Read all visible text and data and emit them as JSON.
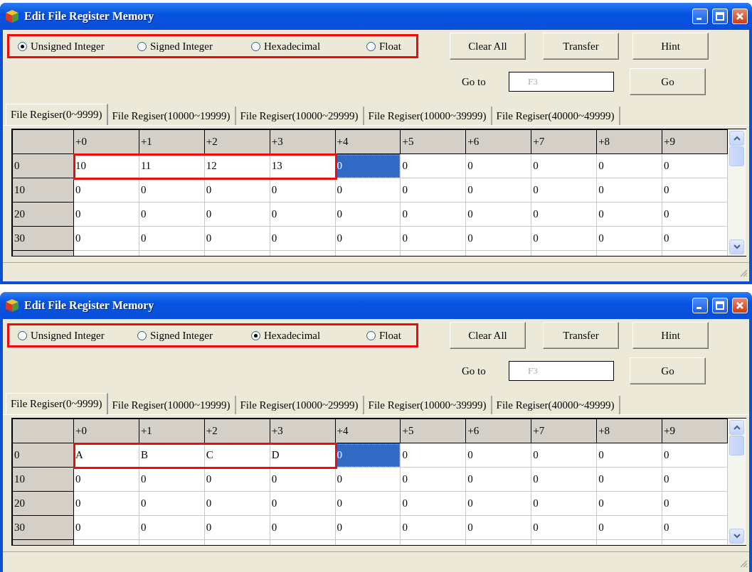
{
  "windows": [
    {
      "title": "Edit File Register Memory",
      "format_group": {
        "highlighted": true,
        "options": [
          {
            "label": "Unsigned Integer",
            "selected": true
          },
          {
            "label": "Signed Integer",
            "selected": false
          },
          {
            "label": "Hexadecimal",
            "selected": false
          },
          {
            "label": "Float",
            "selected": false
          }
        ]
      },
      "buttons": [
        "Clear All",
        "Transfer",
        "Hint"
      ],
      "goto": {
        "label": "Go to",
        "placeholder": "F3",
        "button": "Go"
      },
      "tabs": [
        {
          "label": "File Regiser(0~9999)",
          "selected": true
        },
        {
          "label": "File Regiser(10000~19999)",
          "selected": false
        },
        {
          "label": "File Regiser(10000~29999)",
          "selected": false
        },
        {
          "label": "File Regiser(10000~39999)",
          "selected": false
        },
        {
          "label": "File Regiser(40000~49999)",
          "selected": false
        }
      ],
      "grid": {
        "columns": [
          "+0",
          "+1",
          "+2",
          "+3",
          "+4",
          "+5",
          "+6",
          "+7",
          "+8",
          "+9"
        ],
        "rows": [
          {
            "header": "0",
            "cells": [
              {
                "text": "10",
                "selected": false,
                "highlighted": true
              },
              {
                "text": "11",
                "selected": false,
                "highlighted": true
              },
              {
                "text": "12",
                "selected": false,
                "highlighted": true
              },
              {
                "text": "13",
                "selected": false,
                "highlighted": true
              },
              {
                "text": "0",
                "selected": true,
                "highlighted": false
              },
              {
                "text": "0",
                "selected": false,
                "highlighted": false
              },
              {
                "text": "0",
                "selected": false,
                "highlighted": false
              },
              {
                "text": "0",
                "selected": false,
                "highlighted": false
              },
              {
                "text": "0",
                "selected": false,
                "highlighted": false
              },
              {
                "text": "0",
                "selected": false,
                "highlighted": false
              }
            ]
          },
          {
            "header": "10",
            "cells": [
              {
                "text": "0",
                "selected": false,
                "highlighted": false
              },
              {
                "text": "0",
                "selected": false,
                "highlighted": false
              },
              {
                "text": "0",
                "selected": false,
                "highlighted": false
              },
              {
                "text": "0",
                "selected": false,
                "highlighted": false
              },
              {
                "text": "0",
                "selected": false,
                "highlighted": false
              },
              {
                "text": "0",
                "selected": false,
                "highlighted": false
              },
              {
                "text": "0",
                "selected": false,
                "highlighted": false
              },
              {
                "text": "0",
                "selected": false,
                "highlighted": false
              },
              {
                "text": "0",
                "selected": false,
                "highlighted": false
              },
              {
                "text": "0",
                "selected": false,
                "highlighted": false
              }
            ]
          },
          {
            "header": "20",
            "cells": [
              {
                "text": "0",
                "selected": false,
                "highlighted": false
              },
              {
                "text": "0",
                "selected": false,
                "highlighted": false
              },
              {
                "text": "0",
                "selected": false,
                "highlighted": false
              },
              {
                "text": "0",
                "selected": false,
                "highlighted": false
              },
              {
                "text": "0",
                "selected": false,
                "highlighted": false
              },
              {
                "text": "0",
                "selected": false,
                "highlighted": false
              },
              {
                "text": "0",
                "selected": false,
                "highlighted": false
              },
              {
                "text": "0",
                "selected": false,
                "highlighted": false
              },
              {
                "text": "0",
                "selected": false,
                "highlighted": false
              },
              {
                "text": "0",
                "selected": false,
                "highlighted": false
              }
            ]
          },
          {
            "header": "30",
            "cells": [
              {
                "text": "0",
                "selected": false,
                "highlighted": false
              },
              {
                "text": "0",
                "selected": false,
                "highlighted": false
              },
              {
                "text": "0",
                "selected": false,
                "highlighted": false
              },
              {
                "text": "0",
                "selected": false,
                "highlighted": false
              },
              {
                "text": "0",
                "selected": false,
                "highlighted": false
              },
              {
                "text": "0",
                "selected": false,
                "highlighted": false
              },
              {
                "text": "0",
                "selected": false,
                "highlighted": false
              },
              {
                "text": "0",
                "selected": false,
                "highlighted": false
              },
              {
                "text": "0",
                "selected": false,
                "highlighted": false
              },
              {
                "text": "0",
                "selected": false,
                "highlighted": false
              }
            ]
          }
        ]
      }
    },
    {
      "title": "Edit File Register Memory",
      "format_group": {
        "highlighted": true,
        "options": [
          {
            "label": "Unsigned Integer",
            "selected": false
          },
          {
            "label": "Signed Integer",
            "selected": false
          },
          {
            "label": "Hexadecimal",
            "selected": true
          },
          {
            "label": "Float",
            "selected": false
          }
        ]
      },
      "buttons": [
        "Clear All",
        "Transfer",
        "Hint"
      ],
      "goto": {
        "label": "Go to",
        "placeholder": "F3",
        "button": "Go"
      },
      "tabs": [
        {
          "label": "File Regiser(0~9999)",
          "selected": true
        },
        {
          "label": "File Regiser(10000~19999)",
          "selected": false
        },
        {
          "label": "File Regiser(10000~29999)",
          "selected": false
        },
        {
          "label": "File Regiser(10000~39999)",
          "selected": false
        },
        {
          "label": "File Regiser(40000~49999)",
          "selected": false
        }
      ],
      "grid": {
        "columns": [
          "+0",
          "+1",
          "+2",
          "+3",
          "+4",
          "+5",
          "+6",
          "+7",
          "+8",
          "+9"
        ],
        "rows": [
          {
            "header": "0",
            "cells": [
              {
                "text": "A",
                "selected": false,
                "highlighted": true
              },
              {
                "text": "B",
                "selected": false,
                "highlighted": true
              },
              {
                "text": "C",
                "selected": false,
                "highlighted": true
              },
              {
                "text": "D",
                "selected": false,
                "highlighted": true
              },
              {
                "text": "0",
                "selected": true,
                "highlighted": false
              },
              {
                "text": "0",
                "selected": false,
                "highlighted": false
              },
              {
                "text": "0",
                "selected": false,
                "highlighted": false
              },
              {
                "text": "0",
                "selected": false,
                "highlighted": false
              },
              {
                "text": "0",
                "selected": false,
                "highlighted": false
              },
              {
                "text": "0",
                "selected": false,
                "highlighted": false
              }
            ]
          },
          {
            "header": "10",
            "cells": [
              {
                "text": "0",
                "selected": false,
                "highlighted": false
              },
              {
                "text": "0",
                "selected": false,
                "highlighted": false
              },
              {
                "text": "0",
                "selected": false,
                "highlighted": false
              },
              {
                "text": "0",
                "selected": false,
                "highlighted": false
              },
              {
                "text": "0",
                "selected": false,
                "highlighted": false
              },
              {
                "text": "0",
                "selected": false,
                "highlighted": false
              },
              {
                "text": "0",
                "selected": false,
                "highlighted": false
              },
              {
                "text": "0",
                "selected": false,
                "highlighted": false
              },
              {
                "text": "0",
                "selected": false,
                "highlighted": false
              },
              {
                "text": "0",
                "selected": false,
                "highlighted": false
              }
            ]
          },
          {
            "header": "20",
            "cells": [
              {
                "text": "0",
                "selected": false,
                "highlighted": false
              },
              {
                "text": "0",
                "selected": false,
                "highlighted": false
              },
              {
                "text": "0",
                "selected": false,
                "highlighted": false
              },
              {
                "text": "0",
                "selected": false,
                "highlighted": false
              },
              {
                "text": "0",
                "selected": false,
                "highlighted": false
              },
              {
                "text": "0",
                "selected": false,
                "highlighted": false
              },
              {
                "text": "0",
                "selected": false,
                "highlighted": false
              },
              {
                "text": "0",
                "selected": false,
                "highlighted": false
              },
              {
                "text": "0",
                "selected": false,
                "highlighted": false
              },
              {
                "text": "0",
                "selected": false,
                "highlighted": false
              }
            ]
          },
          {
            "header": "30",
            "cells": [
              {
                "text": "0",
                "selected": false,
                "highlighted": false
              },
              {
                "text": "0",
                "selected": false,
                "highlighted": false
              },
              {
                "text": "0",
                "selected": false,
                "highlighted": false
              },
              {
                "text": "0",
                "selected": false,
                "highlighted": false
              },
              {
                "text": "0",
                "selected": false,
                "highlighted": false
              },
              {
                "text": "0",
                "selected": false,
                "highlighted": false
              },
              {
                "text": "0",
                "selected": false,
                "highlighted": false
              },
              {
                "text": "0",
                "selected": false,
                "highlighted": false
              },
              {
                "text": "0",
                "selected": false,
                "highlighted": false
              },
              {
                "text": "0",
                "selected": false,
                "highlighted": false
              }
            ]
          }
        ]
      }
    }
  ]
}
